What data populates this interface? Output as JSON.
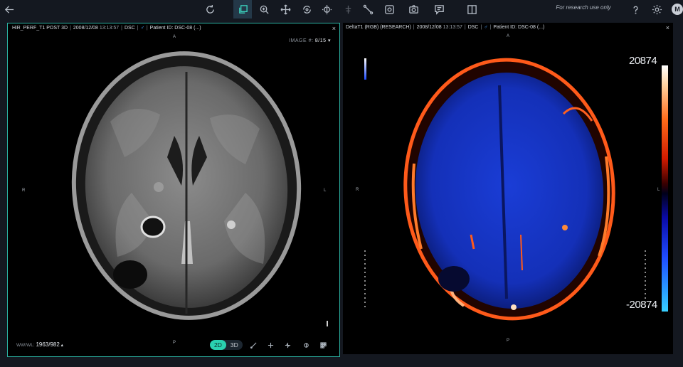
{
  "toolbar": {
    "research_note": "For research use only",
    "avatar_initial": "M"
  },
  "left_viewport": {
    "series": "HiR_PERF_T1 POST 3D",
    "date": "2008/12/08",
    "time": "13:13:57",
    "modality": "DSC",
    "patient_label": "Patient ID: DSC-08",
    "patient_more": "(...)",
    "close": "×",
    "orient_top": "A",
    "orient_bottom": "P",
    "orient_left": "R",
    "orient_right": "L",
    "image_label": "IMAGE #:",
    "image_value": "8/15",
    "wwwl_label": "WW/WL:",
    "wwwl_value": "1963/982",
    "mode_2d": "2D",
    "mode_3d": "3D"
  },
  "right_viewport": {
    "series": "DeltaT1 (RGB) (RESEARCH)",
    "date": "2008/12/08",
    "time": "13:13:57",
    "modality": "DSC",
    "patient_label": "Patient ID: DSC-08",
    "patient_more": "(...)",
    "close": "×",
    "orient_top": "A",
    "orient_bottom": "P",
    "orient_left": "R",
    "orient_right": "L",
    "colorbar_max": "20874",
    "colorbar_min": "-20874"
  }
}
